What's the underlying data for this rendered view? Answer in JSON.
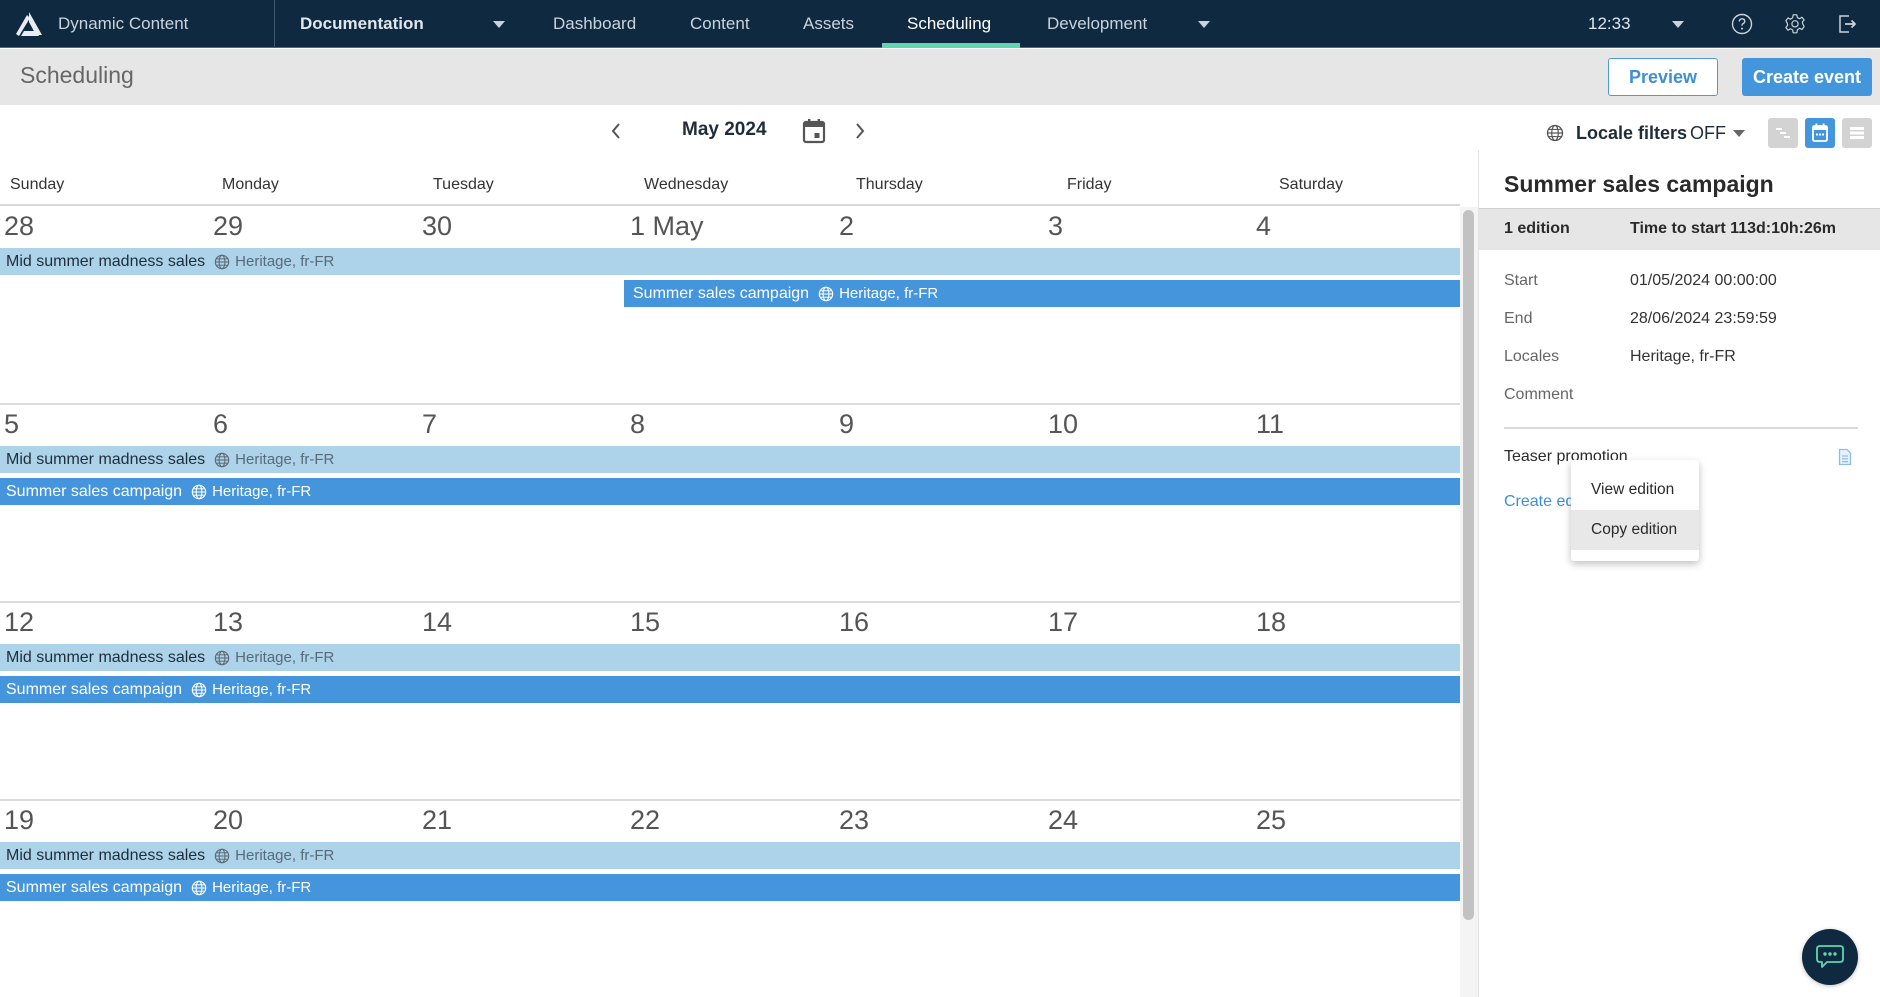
{
  "app": {
    "brand": "Dynamic Content",
    "project": "Documentation",
    "tabs": [
      {
        "label": "Dashboard",
        "active": false
      },
      {
        "label": "Content",
        "active": false
      },
      {
        "label": "Assets",
        "active": false
      },
      {
        "label": "Scheduling",
        "active": true
      },
      {
        "label": "Development",
        "active": false
      }
    ],
    "time": "12:33",
    "accent_color": "#5fd6b0",
    "nav_bg": "#0f2940"
  },
  "header": {
    "title": "Scheduling",
    "preview_label": "Preview",
    "create_label": "Create event"
  },
  "calendar": {
    "month_label": "May 2024",
    "locale_filters_label": "Locale filters",
    "locale_filters_value": "OFF",
    "view_modes": [
      "timeline",
      "calendar",
      "list"
    ],
    "active_view": "calendar",
    "day_names": [
      "Sunday",
      "Monday",
      "Tuesday",
      "Wednesday",
      "Thursday",
      "Friday",
      "Saturday"
    ],
    "weeks": [
      {
        "dates": [
          "28",
          "29",
          "30",
          "1 May",
          "2",
          "3",
          "4"
        ]
      },
      {
        "dates": [
          "5",
          "6",
          "7",
          "8",
          "9",
          "10",
          "11"
        ]
      },
      {
        "dates": [
          "12",
          "13",
          "14",
          "15",
          "16",
          "17",
          "18"
        ]
      },
      {
        "dates": [
          "19",
          "20",
          "21",
          "22",
          "23",
          "24",
          "25"
        ]
      }
    ],
    "events": {
      "mid_summer": {
        "name": "Mid summer madness sales",
        "locales": "Heritage, fr-FR",
        "color": "#acd3ea"
      },
      "summer_sales": {
        "name": "Summer sales campaign",
        "locales": "Heritage, fr-FR",
        "color": "#4495dc"
      }
    }
  },
  "panel": {
    "title": "Summer sales campaign",
    "editions_count": "1 edition",
    "time_to_start": "Time to start 113d:10h:26m",
    "fields": [
      {
        "label": "Start",
        "value": "01/05/2024 00:00:00"
      },
      {
        "label": "End",
        "value": "28/06/2024 23:59:59"
      },
      {
        "label": "Locales",
        "value": "Heritage, fr-FR"
      },
      {
        "label": "Comment",
        "value": ""
      }
    ],
    "edition_name": "Teaser promotion",
    "create_edition_label": "Create edition",
    "context_menu": [
      "View edition",
      "Copy edition"
    ]
  }
}
